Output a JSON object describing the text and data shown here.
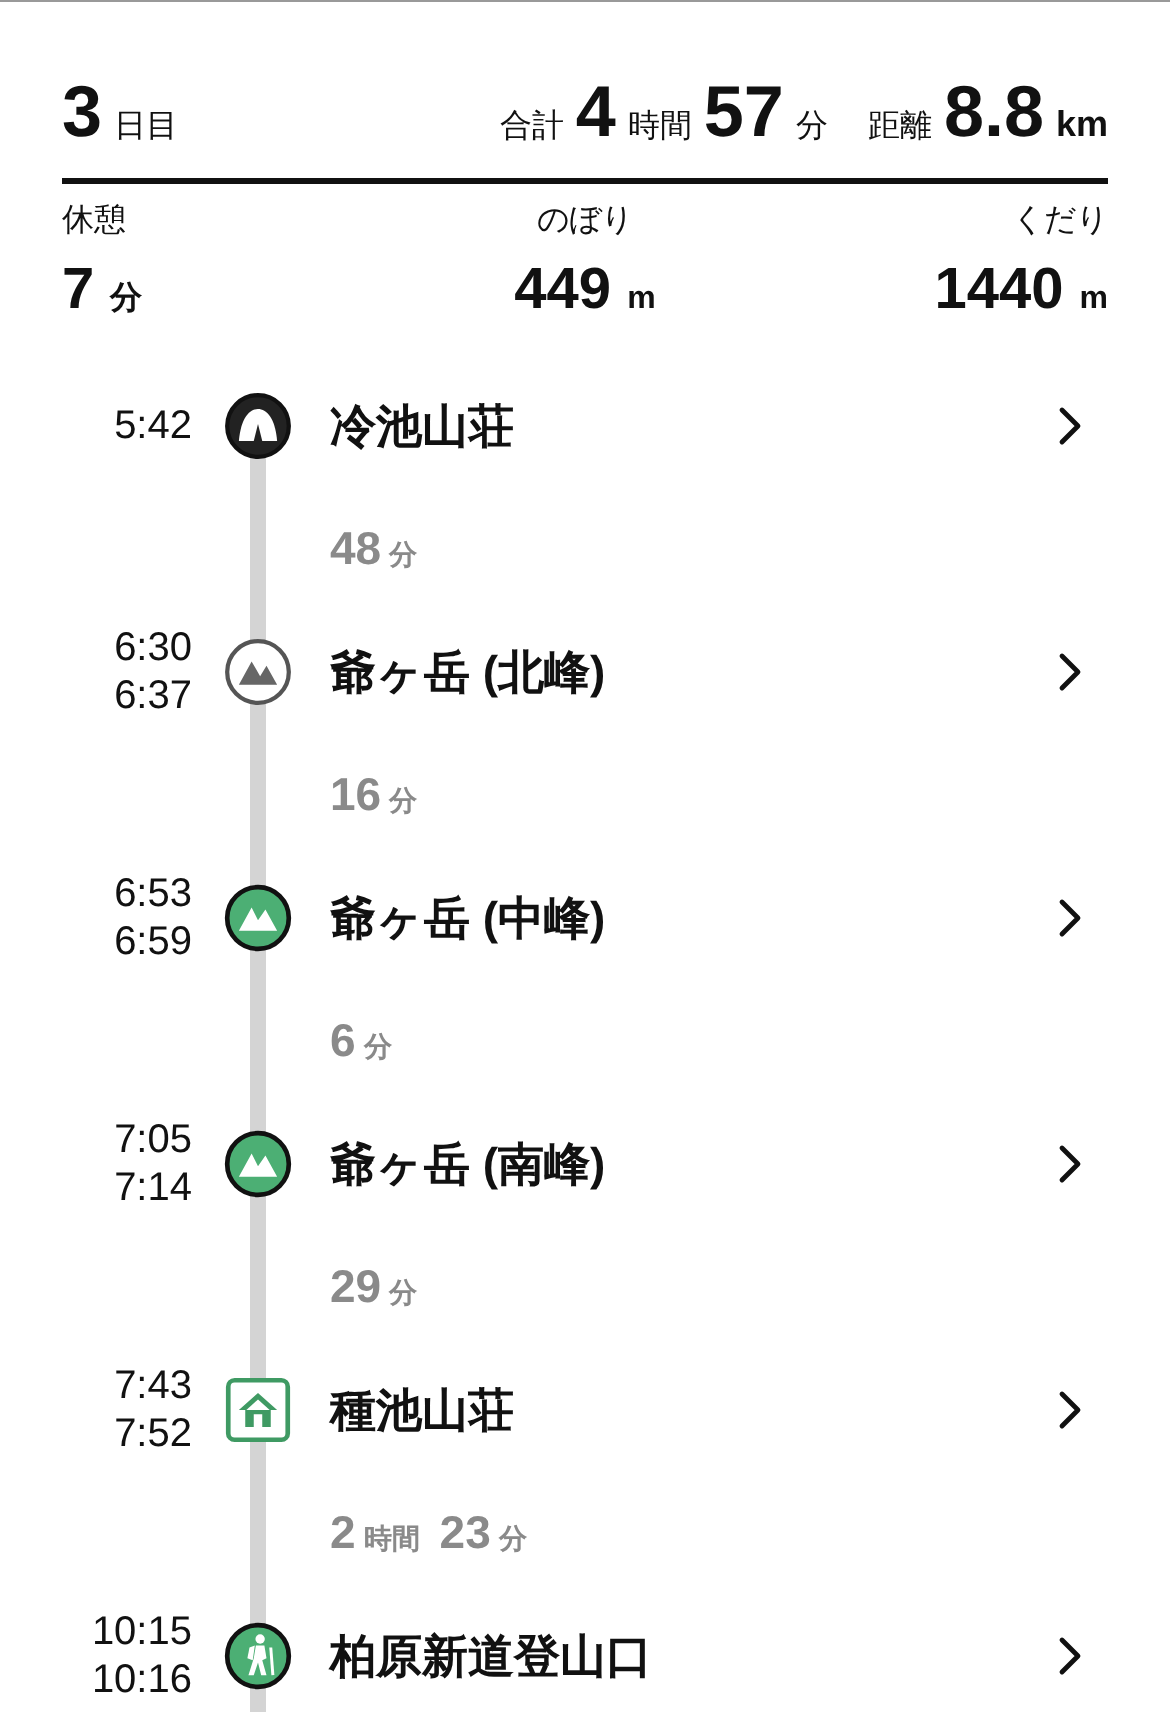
{
  "header": {
    "day": {
      "value": "3",
      "unit": "日目"
    },
    "total": {
      "label": "合計",
      "parts": [
        {
          "value": "4",
          "unit": "時間"
        },
        {
          "value": "57",
          "unit": "分"
        }
      ]
    },
    "distance": {
      "label": "距離",
      "value": "8.8",
      "unit": "km"
    }
  },
  "stats": [
    {
      "label": "休憩",
      "value": "7",
      "unit": "分"
    },
    {
      "label": "のぼり",
      "value": "449",
      "unit": "m"
    },
    {
      "label": "くだり",
      "value": "1440",
      "unit": "m"
    }
  ],
  "route": [
    {
      "kind": "tent",
      "times": [
        "5:42"
      ],
      "name": "冷池山荘",
      "leg": [
        {
          "value": "48",
          "unit": "分"
        }
      ]
    },
    {
      "kind": "peak-outline",
      "times": [
        "6:30",
        "6:37"
      ],
      "name": "爺ヶ岳 (北峰)",
      "leg": [
        {
          "value": "16",
          "unit": "分"
        }
      ]
    },
    {
      "kind": "peak",
      "times": [
        "6:53",
        "6:59"
      ],
      "name": "爺ヶ岳 (中峰)",
      "leg": [
        {
          "value": "6",
          "unit": "分"
        }
      ]
    },
    {
      "kind": "peak",
      "times": [
        "7:05",
        "7:14"
      ],
      "name": "爺ヶ岳 (南峰)",
      "leg": [
        {
          "value": "29",
          "unit": "分"
        }
      ]
    },
    {
      "kind": "hut",
      "times": [
        "7:43",
        "7:52"
      ],
      "name": "種池山荘",
      "leg": [
        {
          "value": "2",
          "unit": "時間"
        },
        {
          "value": "23",
          "unit": "分"
        }
      ]
    },
    {
      "kind": "hiker",
      "times": [
        "10:15",
        "10:16"
      ],
      "name": "柏原新道登山口"
    }
  ]
}
